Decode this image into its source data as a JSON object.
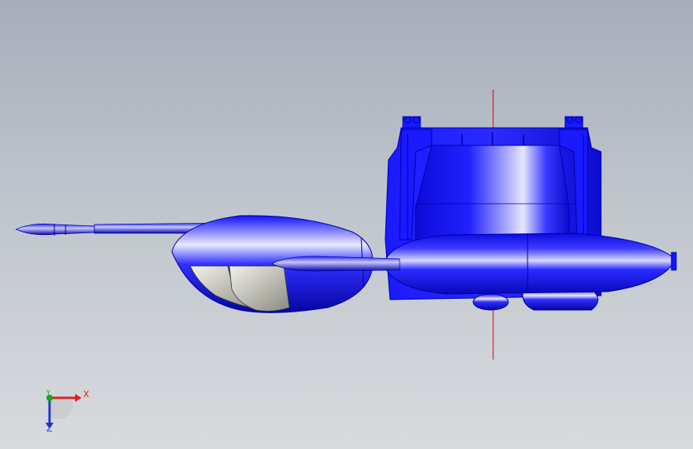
{
  "viewport": {
    "background_top": "#a7aebb",
    "background_bottom": "#d8dbde"
  },
  "model": {
    "body_color": "#1414ff",
    "glass_color": "#b8b8b0",
    "reference_line_color": "#e00000"
  },
  "triad": {
    "x_label": "X",
    "y_label": "Y",
    "z_label": "Z",
    "x_color": "#e0201f",
    "y_color": "#1ea21e",
    "z_color": "#2436c8"
  }
}
